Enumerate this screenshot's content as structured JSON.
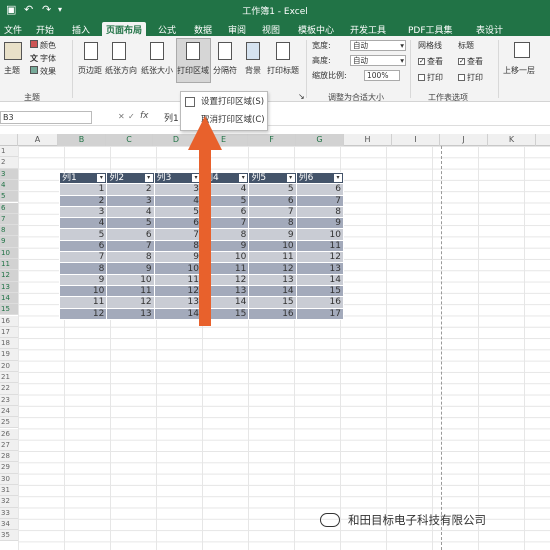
{
  "window": {
    "title": "工作簿1 - Excel"
  },
  "tabs": [
    "文件",
    "开始",
    "插入",
    "页面布局",
    "公式",
    "数据",
    "审阅",
    "视图",
    "模板中心",
    "开发工具",
    "PDF工具集",
    "表设计"
  ],
  "active_tab": "页面布局",
  "ribbon": {
    "theme_group": {
      "main_label": "主题",
      "colors": "颜色",
      "fonts": "字体",
      "effects": "效果",
      "group_label": "主题"
    },
    "page_setup": {
      "margins": "页边距",
      "orientation": "纸张方向",
      "size": "纸张大小",
      "print_area": "打印区域",
      "breaks": "分隔符",
      "background": "背景",
      "print_titles": "打印标题"
    },
    "scale_fit": {
      "width_label": "宽度:",
      "width_value": "自动",
      "height_label": "高度:",
      "height_value": "自动",
      "scale_label": "缩放比例:",
      "scale_value": "100%",
      "group_label": "调整为合适大小"
    },
    "sheet_options": {
      "gridlines": "网格线",
      "headings": "标题",
      "view1": "查看",
      "view2": "查看",
      "print1": "打印",
      "print2": "打印",
      "group_label": "工作表选项"
    },
    "arrange": {
      "bring_forward": "上移一层"
    }
  },
  "formula_bar": {
    "cell_ref": "B3",
    "fx": "fx",
    "content": "列1"
  },
  "dropdown_menu": {
    "items": [
      "设置打印区域(S)",
      "取消打印区域(C)"
    ]
  },
  "columns": [
    "A",
    "B",
    "C",
    "D",
    "E",
    "F",
    "G",
    "H",
    "I",
    "J",
    "K"
  ],
  "rows": [
    "1",
    "2",
    "3",
    "4",
    "5",
    "6",
    "7",
    "8",
    "9",
    "10",
    "11",
    "12",
    "13",
    "14",
    "15",
    "16",
    "17",
    "18",
    "19",
    "20",
    "21",
    "22",
    "23",
    "24",
    "25",
    "26",
    "27",
    "28",
    "29",
    "30",
    "31",
    "32",
    "33",
    "34",
    "35"
  ],
  "table": {
    "headers": [
      "列1",
      "列2",
      "列3",
      "列4",
      "列5",
      "列6"
    ],
    "rows": [
      [
        1,
        2,
        3,
        4,
        5,
        6
      ],
      [
        2,
        3,
        4,
        5,
        6,
        7
      ],
      [
        3,
        4,
        5,
        6,
        7,
        8
      ],
      [
        4,
        5,
        6,
        7,
        8,
        9
      ],
      [
        5,
        6,
        7,
        8,
        9,
        10
      ],
      [
        6,
        7,
        8,
        9,
        10,
        11
      ],
      [
        7,
        8,
        9,
        10,
        11,
        12
      ],
      [
        8,
        9,
        10,
        11,
        12,
        13
      ],
      [
        9,
        10,
        11,
        12,
        13,
        14
      ],
      [
        10,
        11,
        12,
        13,
        14,
        15
      ],
      [
        11,
        12,
        13,
        14,
        15,
        16
      ],
      [
        12,
        13,
        14,
        15,
        16,
        17
      ]
    ]
  },
  "watermark": "和田目标电子科技有限公司",
  "colors": {
    "excel_green": "#217346",
    "header_fill": "#44546a",
    "row_light": "#c9ccd4",
    "row_dark": "#a3aabb",
    "arrow": "#e8612c"
  }
}
